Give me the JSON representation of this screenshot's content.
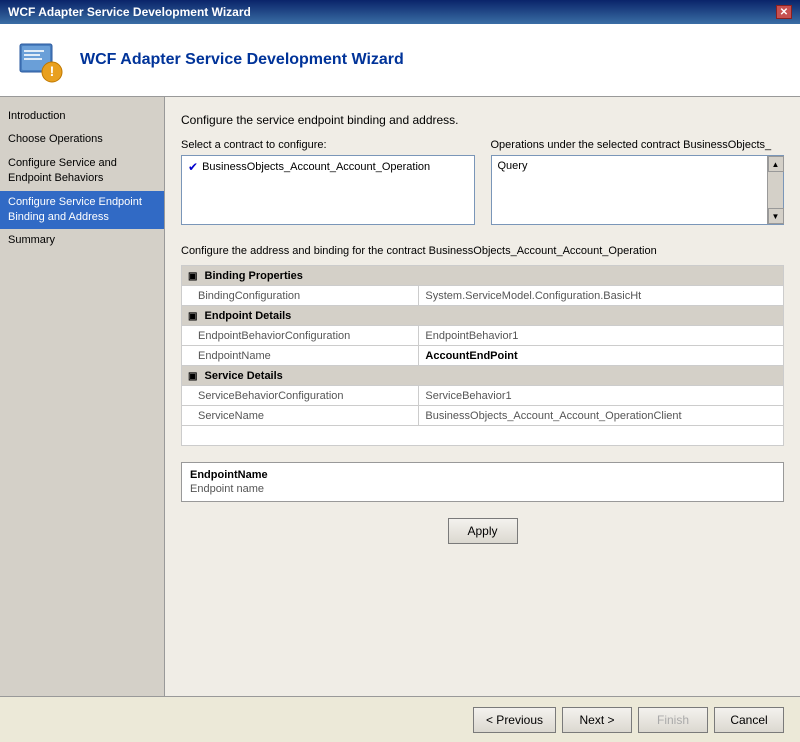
{
  "titleBar": {
    "text": "WCF Adapter Service Development Wizard",
    "closeLabel": "✕"
  },
  "header": {
    "title": "WCF Adapter Service Development Wizard"
  },
  "sidebar": {
    "items": [
      {
        "id": "introduction",
        "label": "Introduction",
        "active": false
      },
      {
        "id": "choose-operations",
        "label": "Choose Operations",
        "active": false
      },
      {
        "id": "configure-service-endpoint-behaviors",
        "label": "Configure Service and\nEndpoint Behaviors",
        "active": false
      },
      {
        "id": "configure-service-endpoint-binding",
        "label": "Configure Service Endpoint Binding and Address",
        "active": true
      },
      {
        "id": "summary",
        "label": "Summary",
        "active": false
      }
    ]
  },
  "content": {
    "topLabel": "Configure the service endpoint binding and address.",
    "contractSection": {
      "leftLabel": "Select a contract to configure:",
      "contractItems": [
        {
          "label": "BusinessObjects_Account_Account_Operation",
          "checked": true
        }
      ],
      "rightLabel": "Operations under the selected contract  BusinessObjects_",
      "operationsItems": [
        {
          "label": "Query"
        }
      ]
    },
    "configureAddressLabel": "Configure the address and binding for the contract  BusinessObjects_Account_Account_Operation",
    "bindingProperties": {
      "sectionHeader": "Binding Properties",
      "rows": [
        {
          "name": "BindingConfiguration",
          "value": "System.ServiceModel.Configuration.BasicHt",
          "bold": false
        }
      ]
    },
    "endpointDetails": {
      "sectionHeader": "Endpoint Details",
      "rows": [
        {
          "name": "EndpointBehaviorConfiguration",
          "value": "EndpointBehavior1",
          "bold": false
        },
        {
          "name": "EndpointName",
          "value": "AccountEndPoint",
          "bold": true
        }
      ]
    },
    "serviceDetails": {
      "sectionHeader": "Service Details",
      "rows": [
        {
          "name": "ServiceBehaviorConfiguration",
          "value": "ServiceBehavior1",
          "bold": false
        },
        {
          "name": "ServiceName",
          "value": "BusinessObjects_Account_Account_OperationClient",
          "bold": false
        }
      ]
    },
    "infoBox": {
      "title": "EndpointName",
      "text": "Endpoint name"
    },
    "applyButton": "Apply"
  },
  "footer": {
    "previousLabel": "< Previous",
    "nextLabel": "Next >",
    "finishLabel": "Finish",
    "cancelLabel": "Cancel"
  }
}
